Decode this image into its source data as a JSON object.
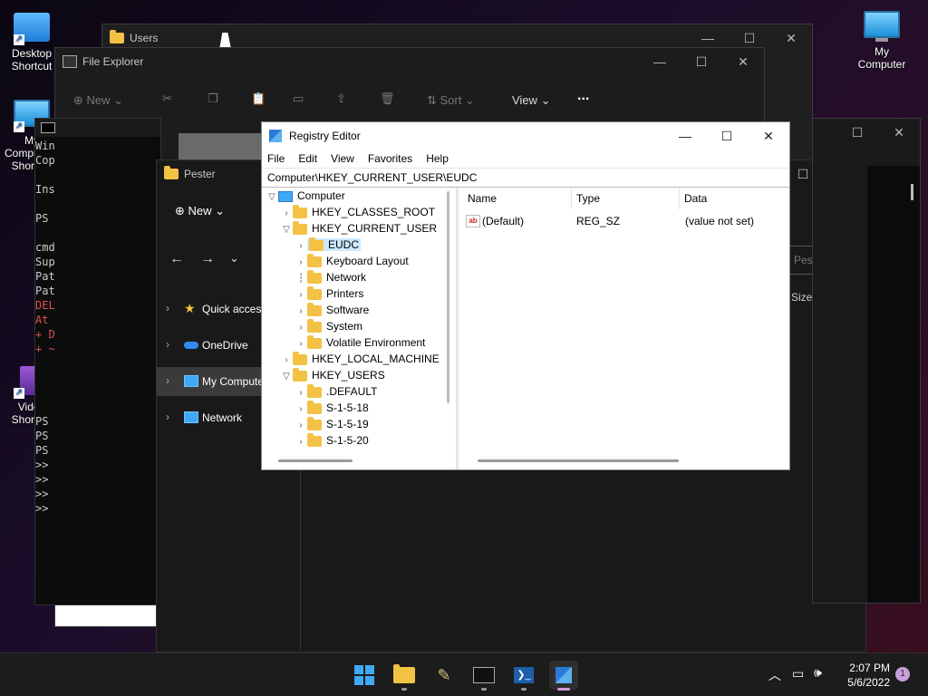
{
  "desktop": {
    "icons": [
      {
        "label": "Desktop Shortcut"
      },
      {
        "label": "My Computer"
      },
      {
        "label": "My Computer - Shortcut"
      },
      {
        "label": "Video Shortcut"
      }
    ]
  },
  "users_window": {
    "title": "Users"
  },
  "file_explorer": {
    "title": "File Explorer",
    "toolbar": {
      "new_label": "New",
      "sort_label": "Sort",
      "view_label": "View",
      "more_label": "..."
    }
  },
  "pester_window": {
    "title": "Pester",
    "new_label": "New",
    "search_placeholder": "Pester",
    "size_header": "Size",
    "nav": [
      {
        "label": "Quick access"
      },
      {
        "label": "OneDrive"
      },
      {
        "label": "My Computer"
      },
      {
        "label": "Network"
      }
    ]
  },
  "terminal": {
    "lines": [
      "Win",
      "Cop",
      "",
      "Ins",
      "",
      "PS ",
      "",
      "cmd",
      "Sup",
      "Pat",
      "Pat",
      "DEL",
      "At ",
      "+ D",
      "+ ~",
      "",
      "",
      "",
      "",
      "PS ",
      "PS ",
      "PS ",
      ">> ",
      ">> ",
      ">> ",
      ">> "
    ],
    "error_color": "#e05050"
  },
  "registry": {
    "title": "Registry Editor",
    "menu": [
      "File",
      "Edit",
      "View",
      "Favorites",
      "Help"
    ],
    "address": "Computer\\HKEY_CURRENT_USER\\EUDC",
    "tree": [
      {
        "label": "Computer"
      },
      {
        "label": "HKEY_CLASSES_ROOT"
      },
      {
        "label": "HKEY_CURRENT_USER"
      },
      {
        "label": "EUDC"
      },
      {
        "label": "Keyboard Layout"
      },
      {
        "label": "Network"
      },
      {
        "label": "Printers"
      },
      {
        "label": "Software"
      },
      {
        "label": "System"
      },
      {
        "label": "Volatile Environment"
      },
      {
        "label": "HKEY_LOCAL_MACHINE"
      },
      {
        "label": "HKEY_USERS"
      },
      {
        "label": ".DEFAULT"
      },
      {
        "label": "S-1-5-18"
      },
      {
        "label": "S-1-5-19"
      },
      {
        "label": "S-1-5-20"
      }
    ],
    "columns": {
      "name": "Name",
      "type": "Type",
      "data": "Data"
    },
    "values": [
      {
        "name": "(Default)",
        "type": "REG_SZ",
        "data": "(value not set)"
      }
    ],
    "selection_color": "#cce8ff"
  },
  "taskbar": {
    "time": "2:07 PM",
    "date": "5/6/2022",
    "notification_count": "1"
  }
}
